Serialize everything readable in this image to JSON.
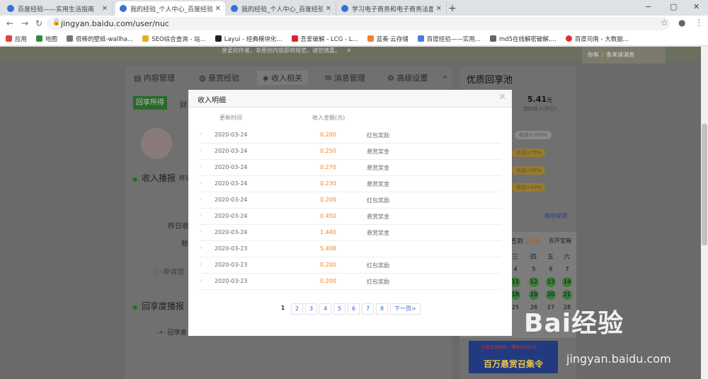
{
  "browser": {
    "tabs": [
      {
        "title": "百度经验——实用生活指南",
        "active": false
      },
      {
        "title": "我的经验_个人中心_百度经验",
        "active": true
      },
      {
        "title": "我的经验_个人中心_百度经验",
        "active": false
      },
      {
        "title": "学习电子商务和电子商务法面临的",
        "active": false
      }
    ],
    "new_tab": "+",
    "window_controls": [
      "−",
      "▢",
      "✕"
    ],
    "url": "jingyan.baidu.com/user/nuc",
    "bookmarks": [
      "应用",
      "地图",
      "很棒的壁纸-wallha...",
      "SEO综合查询 - 站...",
      "Layui - 经典模块化...",
      "吾爱破解 - LCG - L...",
      "蓝奏·云存储",
      "百度经验——实用...",
      "md5在线解密破解,...",
      "百度司南 - 大数据..."
    ]
  },
  "page": {
    "notice": "亲爱的作者，非原创内容即将规范，请您慎重。",
    "notice_close": "✕",
    "msg_tip_prefix": "你有",
    "msg_tip_count": "2",
    "msg_tip_suffix": "条未读消息",
    "left_tabs": [
      "内容管理",
      "悬赏经验",
      "收入相关",
      "消息管理",
      "高级设置"
    ],
    "left_tabs_more": "»",
    "green_button": "回享所得",
    "green_button_sibling": "财",
    "income_heading": "收入播报",
    "income_sub": "昨日",
    "income_row1": "昨日收",
    "income_row2": "账",
    "apply_link": "ⓘ 申请提",
    "ratio_heading": "回享度播报",
    "ratio_sub": "回享度",
    "right_title": "优质回享池",
    "right_value": "5.41",
    "right_value_unit": "元",
    "right_value_label": "我的收入(昨日)",
    "pills": [
      "收益+100%",
      "收益+70%",
      "收益+50%",
      "收益+40%"
    ],
    "rules_link": "规则说明",
    "checkin_prefix": "签到",
    "checkin_days": "15天",
    "checkin_action": "去开宝箱",
    "cal_head": [
      "三",
      "四",
      "五",
      "六"
    ],
    "cal_rows": [
      [
        "4",
        "5",
        "6",
        "7"
      ],
      [
        "11",
        "12",
        "13",
        "14"
      ],
      [
        "18",
        "19",
        "20",
        "21"
      ],
      [
        "25",
        "26",
        "27",
        "28"
      ]
    ],
    "banner_text": "百万悬赏召集令",
    "banner_sub": "分享生活经验，赚取万元奖金"
  },
  "modal": {
    "title": "收入明细",
    "close": "✕",
    "col_time": "更新时间",
    "col_amount": "收入金额(元)",
    "rows": [
      {
        "date": "2020-03-24",
        "amount": "0.200",
        "type": "红包奖励"
      },
      {
        "date": "2020-03-24",
        "amount": "0.250",
        "type": "悬赏奖金"
      },
      {
        "date": "2020-03-24",
        "amount": "0.270",
        "type": "悬赏奖金"
      },
      {
        "date": "2020-03-24",
        "amount": "0.230",
        "type": "悬赏奖金"
      },
      {
        "date": "2020-03-24",
        "amount": "0.200",
        "type": "红包奖励"
      },
      {
        "date": "2020-03-24",
        "amount": "0.450",
        "type": "悬赏奖金"
      },
      {
        "date": "2020-03-24",
        "amount": "1.440",
        "type": "悬赏奖金"
      },
      {
        "date": "2020-03-23",
        "amount": "5.408",
        "type": ""
      },
      {
        "date": "2020-03-23",
        "amount": "0.200",
        "type": "红包奖励"
      },
      {
        "date": "2020-03-23",
        "amount": "0.200",
        "type": "红包奖励"
      }
    ],
    "pages": [
      "1",
      "2",
      "3",
      "4",
      "5",
      "6",
      "7",
      "8"
    ],
    "current_page": "1",
    "next_label": "下一页>"
  },
  "watermark": {
    "brand": "Bai经验",
    "url": "jingyan.baidu.com"
  },
  "colors": {
    "accent_orange": "#f58220",
    "brand_green": "#2a9a2a",
    "link_blue": "#3366cc"
  }
}
